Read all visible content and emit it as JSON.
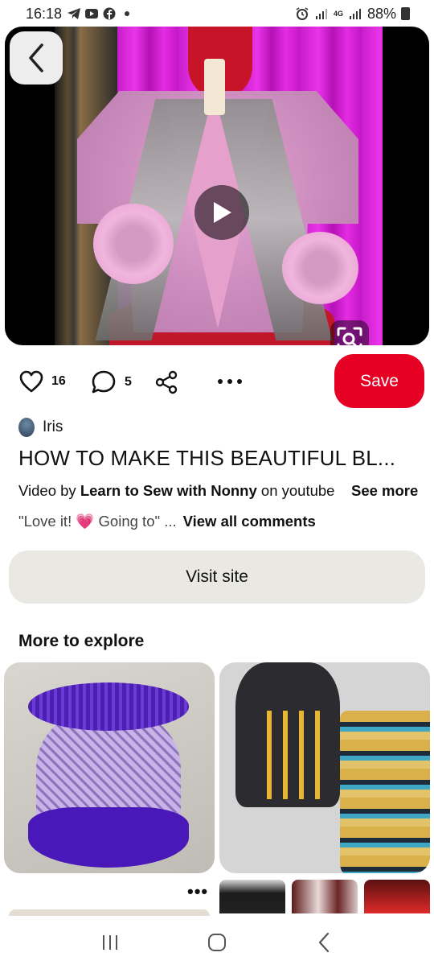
{
  "status_bar": {
    "time": "16:18",
    "battery": "88%",
    "network": "4G",
    "icons": [
      "telegram-icon",
      "youtube-icon",
      "facebook-icon",
      "dot",
      "alarm-icon",
      "signal-icon",
      "signal-icon",
      "battery-icon"
    ]
  },
  "media": {
    "type": "video",
    "icons": {
      "back": "chevron-left-icon",
      "play": "play-icon",
      "lens": "visual-search-icon"
    }
  },
  "actions": {
    "likes": "16",
    "comments": "5",
    "save_label": "Save",
    "icons": [
      "heart-icon",
      "comment-icon",
      "share-icon",
      "more-icon"
    ]
  },
  "pin": {
    "author": "Iris",
    "title": "HOW TO MAKE THIS BEAUTIFUL BL...",
    "source_prefix": "Video by ",
    "source_name": "Learn to Sew with Nonny",
    "source_suffix": " on youtube",
    "see_more": "See more",
    "comment_preview_a": "\"Love it! ",
    "comment_emoji": "💗",
    "comment_preview_b": " Going to\" ...",
    "view_all_comments": "View all comments",
    "visit_site": "Visit site"
  },
  "explore": {
    "heading": "More to explore",
    "more": "•••"
  },
  "colors": {
    "brand_red": "#e60023",
    "visit_bg": "#e9e8e2",
    "heart_pink": "#e8467c"
  },
  "nav": {
    "icons": [
      "recent-apps-icon",
      "home-icon",
      "back-icon"
    ]
  }
}
